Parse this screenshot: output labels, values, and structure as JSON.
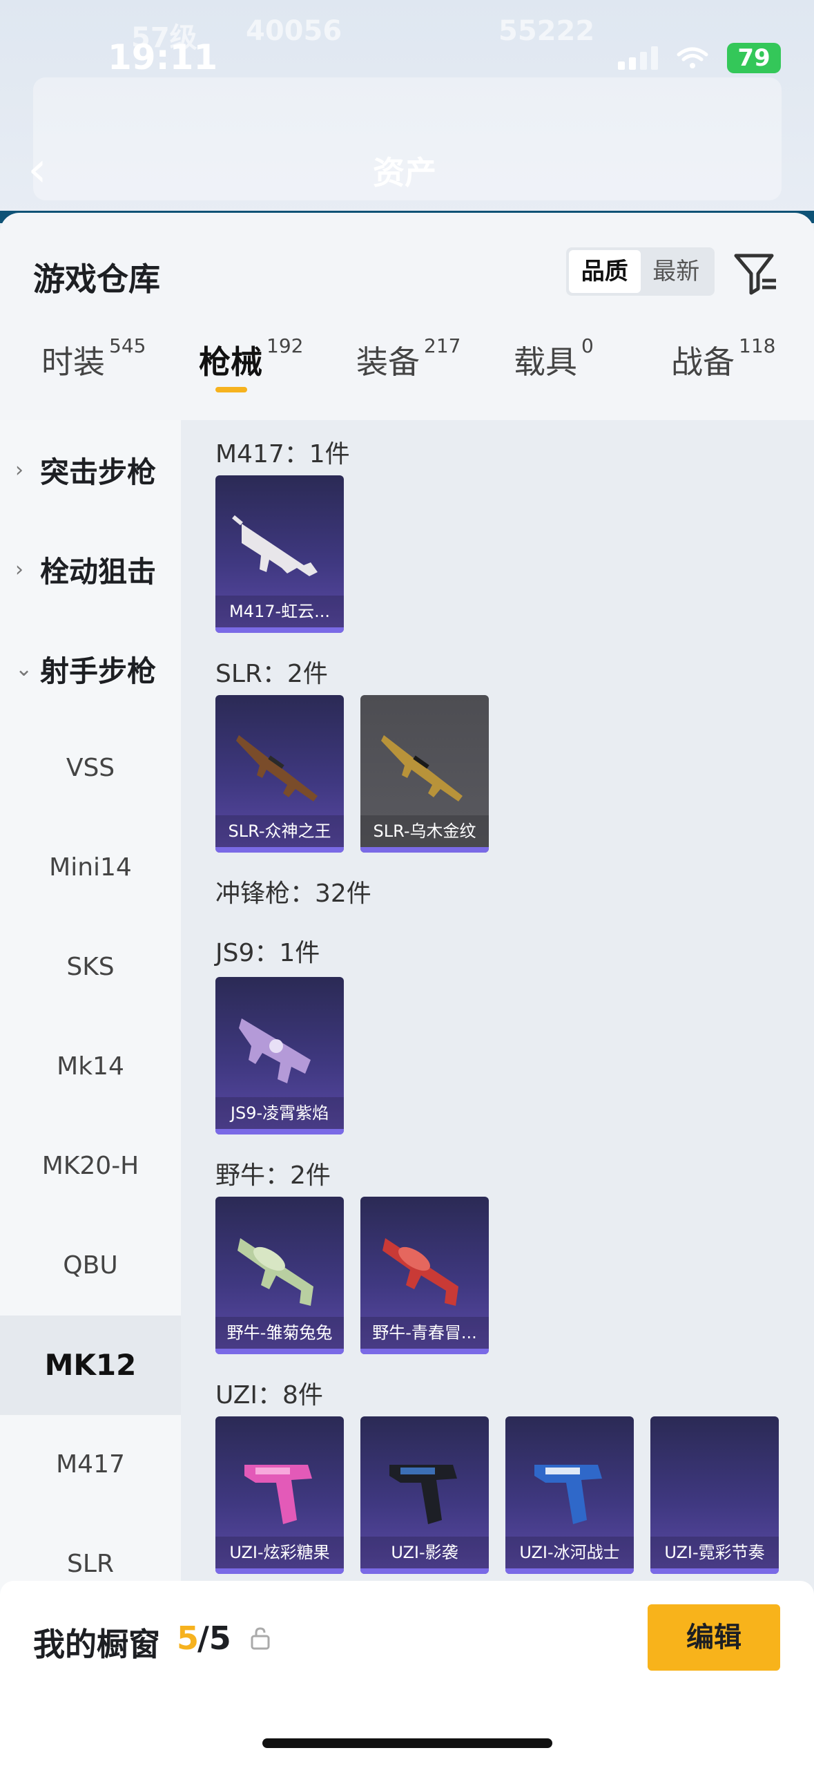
{
  "status_bar": {
    "time": "19:11",
    "battery": "79"
  },
  "background": {
    "level_text": "57级",
    "views": "40056",
    "likes": "55222",
    "nav_title": "资产"
  },
  "sheet": {
    "title": "游戏仓库",
    "sort": [
      {
        "label": "品质",
        "active": true
      },
      {
        "label": "最新",
        "active": false
      }
    ]
  },
  "tabs": [
    {
      "label": "时装",
      "count": "545"
    },
    {
      "label": "枪械",
      "count": "192"
    },
    {
      "label": "装备",
      "count": "217"
    },
    {
      "label": "载具",
      "count": "0"
    },
    {
      "label": "战备",
      "count": "118"
    }
  ],
  "left_nav": {
    "categories": [
      {
        "label": "突击步枪"
      },
      {
        "label": "栓动狙击"
      },
      {
        "label": "射手步枪"
      }
    ],
    "subs": [
      "VSS",
      "Mini14",
      "SKS",
      "Mk14",
      "MK20-H",
      "QBU",
      "MK12",
      "M417",
      "SLR"
    ]
  },
  "groups": [
    {
      "title": "M417：1件",
      "items": [
        "M417-虹云..."
      ]
    },
    {
      "title": "SLR：2件",
      "items": [
        "SLR-众神之王",
        "SLR-乌木金纹"
      ]
    },
    {
      "title": "冲锋枪：32件"
    },
    {
      "title": "JS9：1件",
      "items": [
        "JS9-凌霄紫焰"
      ]
    },
    {
      "title": "野牛：2件",
      "items": [
        "野牛-雏菊兔兔",
        "野牛-青春冒..."
      ]
    },
    {
      "title": "UZI：8件",
      "items": [
        "UZI-炫彩糖果",
        "UZI-影袭",
        "UZI-冰河战士",
        "UZI-霓彩节奏"
      ]
    }
  ],
  "showcase": {
    "label": "我的橱窗",
    "count": "5",
    "total": "/5",
    "edit_label": "编辑"
  },
  "colors": {
    "accent": "#f6b21e",
    "card_bg": "#3f3880",
    "battery": "#34c759"
  }
}
